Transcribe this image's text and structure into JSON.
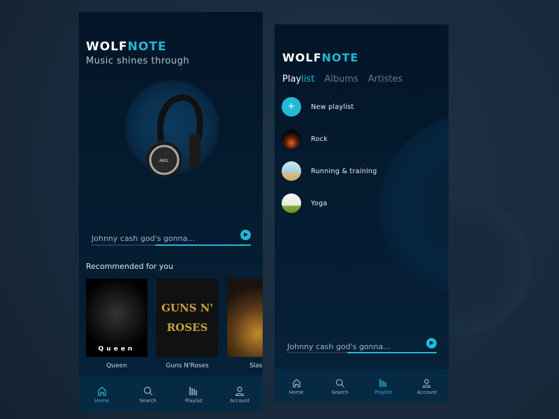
{
  "colors": {
    "accent": "#22b8d6",
    "background": "#041527"
  },
  "home": {
    "logo_a": "WOLF",
    "logo_b": "NOTE",
    "tagline": "Music shines through",
    "player": {
      "track": "Johnny cash god's gonna...",
      "progress": 0.6
    },
    "recommended_title": "Recommended for you",
    "cards": [
      {
        "label": "Queen",
        "art_text": "Queen"
      },
      {
        "label": "Guns N'Roses",
        "art_text": "GUNS N' ROSES"
      },
      {
        "label": "Slash"
      }
    ],
    "nav": [
      {
        "label": "Home",
        "icon": "home-icon",
        "active": true
      },
      {
        "label": "Search",
        "icon": "search-icon"
      },
      {
        "label": "Playlist",
        "icon": "playlist-icon"
      },
      {
        "label": "Account",
        "icon": "account-icon"
      }
    ]
  },
  "playlist": {
    "logo_a": "WOLF",
    "logo_b": "NOTE",
    "tabs": {
      "active_a": "Play",
      "active_b": "list",
      "albums": "Albums",
      "artistes": "Artistes"
    },
    "items": [
      {
        "label": "New playlist",
        "icon": "plus-icon"
      },
      {
        "label": "Rock"
      },
      {
        "label": "Running & training"
      },
      {
        "label": "Yoga"
      }
    ],
    "player": {
      "track": "Johnny cash god's gonna...",
      "progress": 0.6
    },
    "nav": [
      {
        "label": "Home",
        "icon": "home-icon"
      },
      {
        "label": "Search",
        "icon": "search-icon"
      },
      {
        "label": "Playlist",
        "icon": "playlist-icon",
        "active": true
      },
      {
        "label": "Account",
        "icon": "account-icon"
      }
    ]
  }
}
